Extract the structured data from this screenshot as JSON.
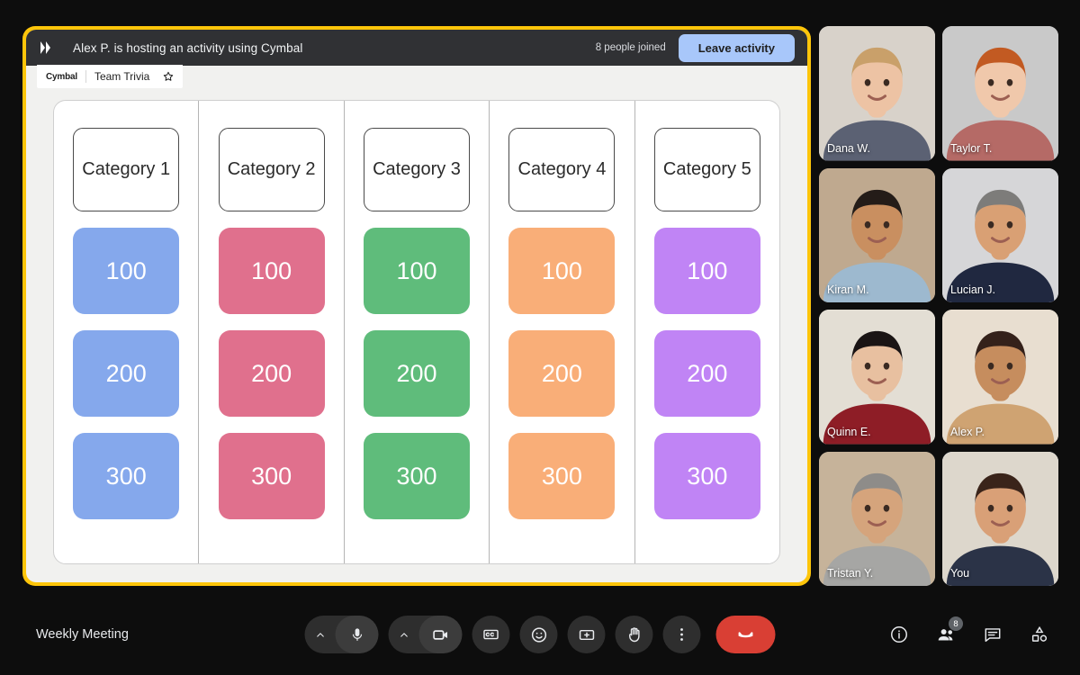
{
  "activity": {
    "logo_icon": "cymbal-logo-icon",
    "host_text": "Alex P. is hosting an activity using Cymbal",
    "people_joined": "8 people joined",
    "leave_label": "Leave activity",
    "app_brand": "Cymbal",
    "app_title": "Team Trivia",
    "star_icon": "star-icon",
    "colors": {
      "frame": "#fdc50a",
      "header_bg": "#303134",
      "leave_button": "#a8c7fa",
      "board_bg": "#f1f1ef"
    }
  },
  "board": {
    "columns": [
      {
        "category": "Category 1",
        "color": "#85a8ec",
        "tiles": [
          "100",
          "200",
          "300"
        ]
      },
      {
        "category": "Category 2",
        "color": "#e0708d",
        "tiles": [
          "100",
          "200",
          "300"
        ]
      },
      {
        "category": "Category 3",
        "color": "#5fbc7b",
        "tiles": [
          "100",
          "200",
          "300"
        ]
      },
      {
        "category": "Category 4",
        "color": "#f9ae78",
        "tiles": [
          "100",
          "200",
          "300"
        ]
      },
      {
        "category": "Category 5",
        "color": "#c084f5",
        "tiles": [
          "100",
          "200",
          "300"
        ]
      }
    ]
  },
  "participants": [
    {
      "name": "Dana W.",
      "self": false
    },
    {
      "name": "Taylor T.",
      "self": false
    },
    {
      "name": "Kiran M.",
      "self": false
    },
    {
      "name": "Lucian J.",
      "self": false
    },
    {
      "name": "Quinn E.",
      "self": false
    },
    {
      "name": "Alex P.",
      "self": false
    },
    {
      "name": "Tristan Y.",
      "self": false
    },
    {
      "name": "You",
      "self": true
    }
  ],
  "bottom_bar": {
    "meeting_name": "Weekly Meeting",
    "controls": [
      {
        "icon": "microphone-icon",
        "chevron": "chevron-up-icon"
      },
      {
        "icon": "camera-icon",
        "chevron": "chevron-up-icon"
      },
      {
        "icon": "closed-captions-icon"
      },
      {
        "icon": "emoji-reaction-icon"
      },
      {
        "icon": "present-screen-icon"
      },
      {
        "icon": "raise-hand-icon"
      },
      {
        "icon": "more-options-icon"
      },
      {
        "icon": "end-call-icon",
        "color": "#d93f34"
      }
    ],
    "right_controls": [
      {
        "icon": "info-icon"
      },
      {
        "icon": "people-icon",
        "badge": "8"
      },
      {
        "icon": "chat-icon"
      },
      {
        "icon": "activities-icon"
      }
    ]
  }
}
